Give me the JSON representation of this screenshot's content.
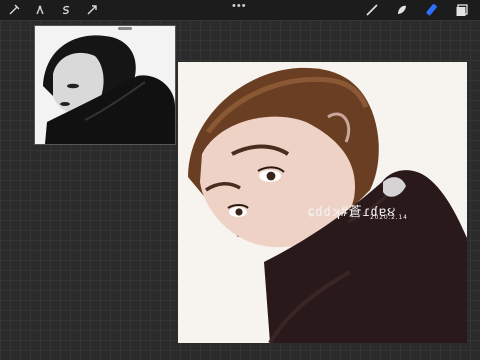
{
  "toolbar": {
    "left_tools": [
      "actions-icon",
      "adjustments-icon",
      "selection-icon",
      "transform-icon"
    ],
    "more_label": "•••",
    "right_tools": [
      "brush-icon",
      "smudge-icon",
      "eraser-icon",
      "layers-icon"
    ],
    "active_color": "#2f6fff"
  },
  "artwork": {
    "signature_text": "ɕɗɗʞ#蒼ɾɗɐ૪",
    "date_text": "2020.2.14"
  }
}
